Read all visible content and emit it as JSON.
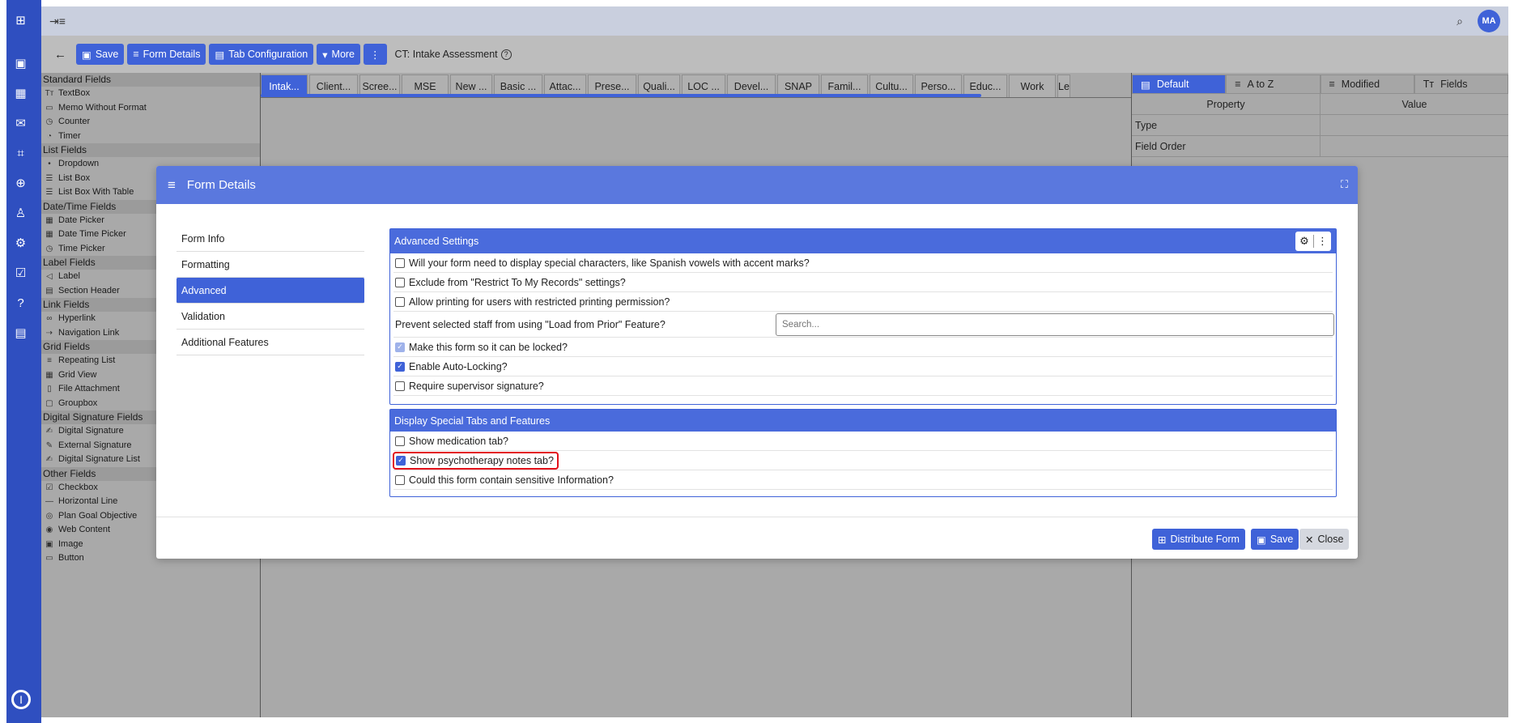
{
  "topbar": {
    "avatar_initials": "MA"
  },
  "toolbar": {
    "save_label": "Save",
    "form_details_label": "Form Details",
    "tab_config_label": "Tab Configuration",
    "more_label": "More",
    "breadcrumb": "CT: Intake Assessment"
  },
  "palette": {
    "groups": [
      {
        "title": "Standard Fields",
        "items": [
          "TextBox",
          "Memo Without Format",
          "Counter",
          "Timer"
        ]
      },
      {
        "title": "List Fields",
        "items": [
          "Dropdown",
          "List Box",
          "List Box With Table"
        ]
      },
      {
        "title": "Date/Time Fields",
        "items": [
          "Date Picker",
          "Date Time Picker",
          "Time Picker"
        ]
      },
      {
        "title": "Label Fields",
        "items": [
          "Label",
          "Section Header"
        ]
      },
      {
        "title": "Link Fields",
        "items": [
          "Hyperlink",
          "Navigation Link"
        ]
      },
      {
        "title": "Grid Fields",
        "items": [
          "Repeating List",
          "Grid View",
          "File Attachment",
          "Groupbox"
        ]
      },
      {
        "title": "Digital Signature Fields",
        "items": [
          "Digital Signature",
          "External Signature",
          "Digital Signature List"
        ]
      },
      {
        "title": "Other Fields",
        "items": [
          "Checkbox",
          "Horizontal Line",
          "Plan Goal Objective",
          "Web Content",
          "Image",
          "Button"
        ]
      }
    ]
  },
  "form_tabs": [
    "Intak...",
    "Client...",
    "Scree...",
    "MSE",
    "New ...",
    "Basic ...",
    "Attac...",
    "Prese...",
    "Quali...",
    "LOC ...",
    "Devel...",
    "SNAP",
    "Famil...",
    "Cultu...",
    "Perso...",
    "Educ...",
    "Work",
    "Le"
  ],
  "properties": {
    "tabs": [
      "Default",
      "A to Z",
      "Modified",
      "Fields"
    ],
    "col_property": "Property",
    "col_value": "Value",
    "rows": [
      "Type",
      "Field Order"
    ]
  },
  "modal": {
    "title": "Form Details",
    "nav": [
      "Form Info",
      "Formatting",
      "Advanced",
      "Validation",
      "Additional Features"
    ],
    "advanced": {
      "title": "Advanced Settings",
      "opt1": "Will your form need to display special characters, like Spanish vowels with accent marks?",
      "opt2": "Exclude from \"Restrict To My Records\" settings?",
      "opt3": "Allow printing for users with restricted printing permission?",
      "prevent_label": "Prevent selected staff from using \"Load from Prior\" Feature?",
      "search_placeholder": "Search...",
      "opt4": "Make this form so it can be locked?",
      "opt5": "Enable Auto-Locking?",
      "opt6": "Require supervisor signature?"
    },
    "special": {
      "title": "Display Special Tabs and Features",
      "opt1": "Show medication tab?",
      "opt2": "Show psychotherapy notes tab?",
      "opt3": "Could this form contain sensitive Information?"
    },
    "footer": {
      "distribute_label": "Distribute Form",
      "save_label": "Save",
      "close_label": "Close"
    }
  }
}
